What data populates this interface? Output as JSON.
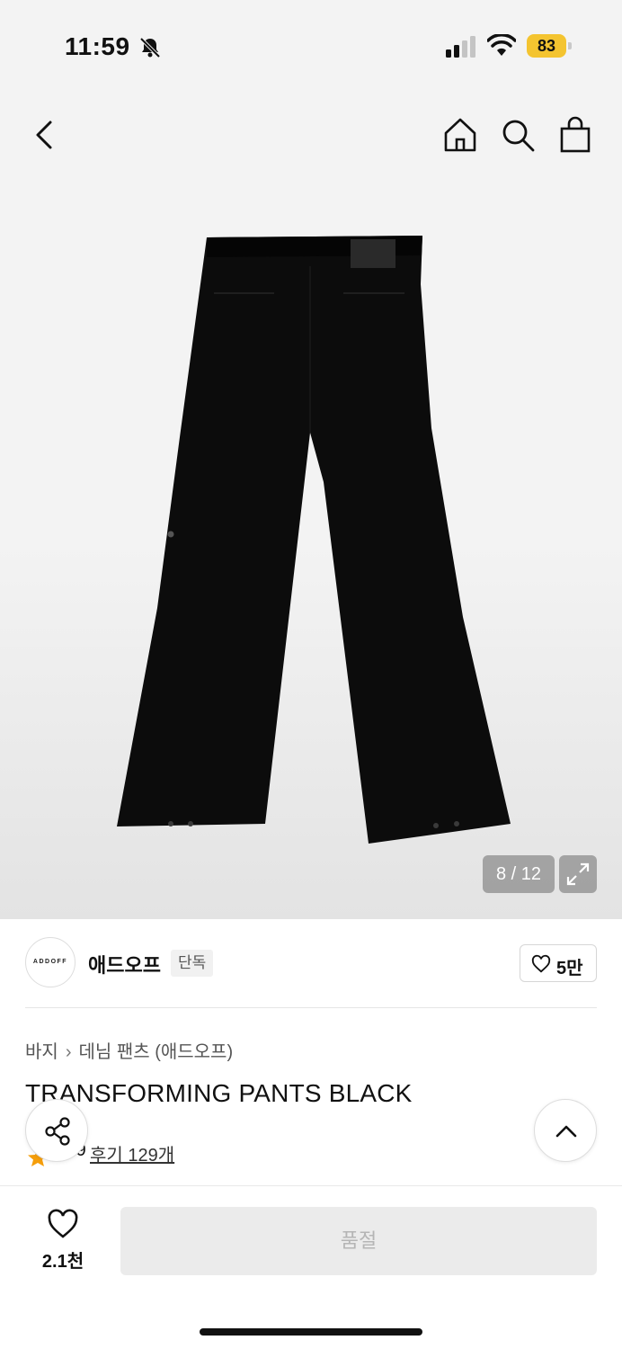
{
  "status_bar": {
    "time": "11:59",
    "battery": "83",
    "icons": [
      "bell-slash-icon",
      "signal-icon",
      "wifi-icon",
      "battery-icon"
    ]
  },
  "nav": {
    "icons": [
      "back-icon",
      "home-icon",
      "search-icon",
      "cart-icon"
    ]
  },
  "gallery": {
    "counter": "8 / 12",
    "current": 8,
    "total": 12,
    "expand_icon": "expand-icon"
  },
  "brand": {
    "logo_text": "ADDOFF",
    "name": "애드오프",
    "badge": "단독",
    "likes": "5만"
  },
  "product": {
    "breadcrumb": [
      "바지",
      "데님 팬츠 (애드오프)"
    ],
    "title": "TRANSFORMING PANTS BLACK",
    "rating": "4.9",
    "reviews": "후기 129개"
  },
  "bottom_bar": {
    "wish_count": "2.1천",
    "buy_label": "품절"
  },
  "colors": {
    "accent_star": "#f59e0b",
    "battery": "#f4c430",
    "disabled_button": "#ebebeb"
  }
}
